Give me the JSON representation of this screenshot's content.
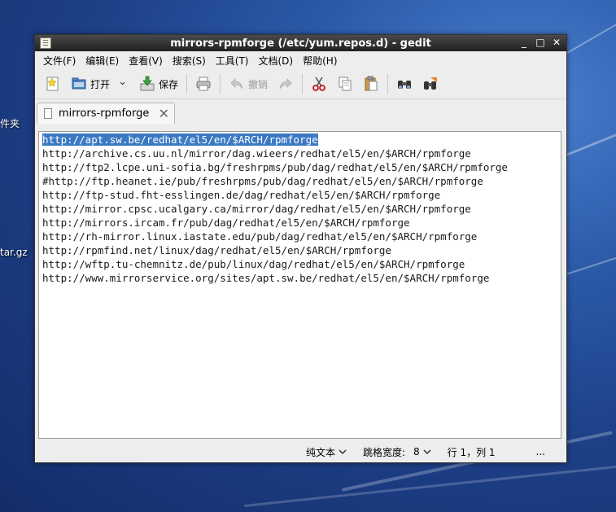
{
  "desktop": {
    "label_1": "件夹",
    "label_2": "tar.gz"
  },
  "window": {
    "title": "mirrors-rpmforge (/etc/yum.repos.d) - gedit",
    "controls": {
      "minimize": "_",
      "maximize": "□",
      "close": "✕"
    }
  },
  "menu": [
    "文件(F)",
    "编辑(E)",
    "查看(V)",
    "搜索(S)",
    "工具(T)",
    "文档(D)",
    "帮助(H)"
  ],
  "toolbar": {
    "open_label": "打开",
    "save_label": "保存",
    "undo_label": "撤销"
  },
  "tab": {
    "title": "mirrors-rpmforge"
  },
  "editor": {
    "lines": [
      "http://apt.sw.be/redhat/el5/en/$ARCH/rpmforge",
      "http://archive.cs.uu.nl/mirror/dag.wieers/redhat/el5/en/$ARCH/rpmforge",
      "http://ftp2.lcpe.uni-sofia.bg/freshrpms/pub/dag/redhat/el5/en/$ARCH/rpmforge",
      "#http://ftp.heanet.ie/pub/freshrpms/pub/dag/redhat/el5/en/$ARCH/rpmforge",
      "http://ftp-stud.fht-esslingen.de/dag/redhat/el5/en/$ARCH/rpmforge",
      "http://mirror.cpsc.ucalgary.ca/mirror/dag/redhat/el5/en/$ARCH/rpmforge",
      "http://mirrors.ircam.fr/pub/dag/redhat/el5/en/$ARCH/rpmforge",
      "http://rh-mirror.linux.iastate.edu/pub/dag/redhat/el5/en/$ARCH/rpmforge",
      "http://rpmfind.net/linux/dag/redhat/el5/en/$ARCH/rpmforge",
      "http://wftp.tu-chemnitz.de/pub/linux/dag/redhat/el5/en/$ARCH/rpmforge",
      "http://www.mirrorservice.org/sites/apt.sw.be/redhat/el5/en/$ARCH/rpmforge"
    ],
    "selected_line": 0
  },
  "status": {
    "language": "纯文本",
    "tab_width_label": "跳格宽度:",
    "tab_width_value": "8",
    "position": "行 1，列 1",
    "more": "..."
  }
}
